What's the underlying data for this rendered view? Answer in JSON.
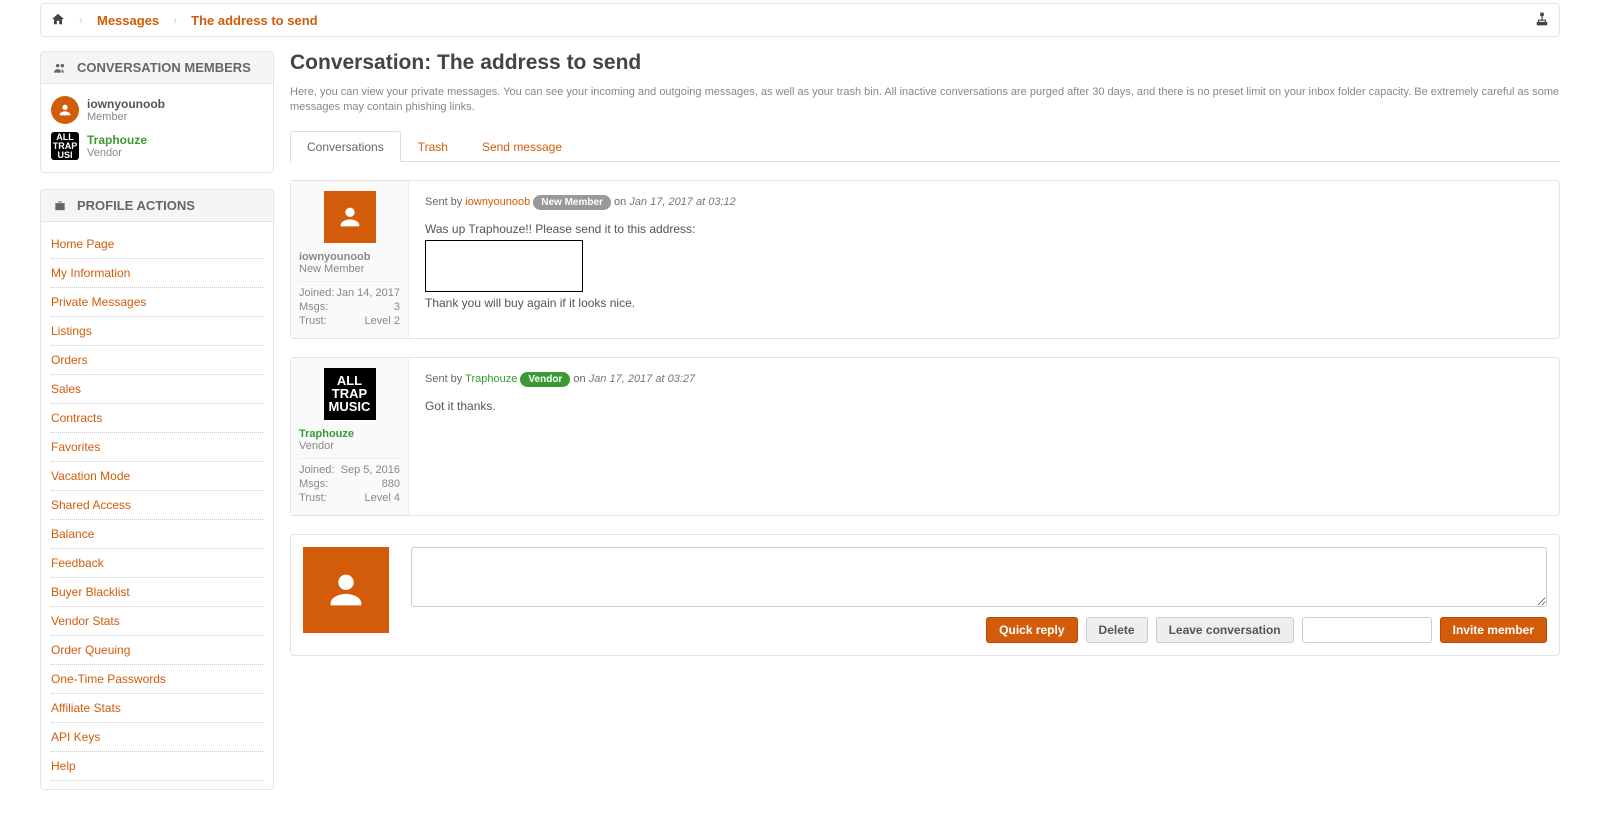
{
  "breadcrumb": {
    "messages": "Messages",
    "current": "The address to send"
  },
  "members_panel": {
    "title": "CONVERSATION MEMBERS",
    "list": [
      {
        "name": "iownyounoob",
        "role": "Member",
        "vendor": false
      },
      {
        "name": "Traphouze",
        "role": "Vendor",
        "vendor": true
      }
    ]
  },
  "profile_panel": {
    "title": "PROFILE ACTIONS",
    "items": [
      "Home Page",
      "My Information",
      "Private Messages",
      "Listings",
      "Orders",
      "Sales",
      "Contracts",
      "Favorites",
      "Vacation Mode",
      "Shared Access",
      "Balance",
      "Feedback",
      "Buyer Blacklist",
      "Vendor Stats",
      "Order Queuing",
      "One-Time Passwords",
      "Affiliate Stats",
      "API Keys",
      "Help"
    ]
  },
  "heading": "Conversation: The address to send",
  "description": "Here, you can view your private messages. You can see your incoming and outgoing messages, as well as your trash bin. All inactive conversations are purged after 30 days, and there is no preset limit on your inbox folder capacity. Be extremely careful as some messages may contain phishing links.",
  "tabs": {
    "conversations": "Conversations",
    "trash": "Trash",
    "send": "Send message"
  },
  "labels": {
    "sent_by": "Sent by ",
    "on": " on ",
    "joined": "Joined:",
    "msgs": "Msgs:",
    "trust": "Trust:"
  },
  "messages": [
    {
      "sender": "iownyounoob",
      "vendor": false,
      "badge": "New Member",
      "badge_class": "grey",
      "date": "Jan 17, 2017 at 03:12",
      "role": "New Member",
      "joined": "Jan 14, 2017",
      "msgs": "3",
      "trust": "Level 2",
      "body_line1": "Was up Traphouze!! Please send it to this address:",
      "body_line2": "",
      "body_line3": "Thank you will buy again if it looks nice.",
      "redacted": true
    },
    {
      "sender": "Traphouze",
      "vendor": true,
      "badge": "Vendor",
      "badge_class": "green",
      "date": "Jan 17, 2017 at 03:27",
      "role": "Vendor",
      "joined": "Sep 5, 2016",
      "msgs": "880",
      "trust": "Level 4",
      "body_line1": "Got it thanks.",
      "body_line2": "",
      "body_line3": "",
      "redacted": false
    }
  ],
  "reply": {
    "quick_reply": "Quick reply",
    "delete": "Delete",
    "leave": "Leave conversation",
    "invite": "Invite member",
    "invite_placeholder": ""
  }
}
